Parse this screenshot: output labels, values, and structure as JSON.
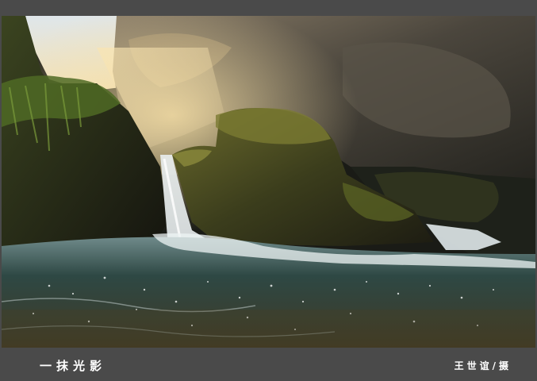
{
  "photo": {
    "subject": "waterfall-rocks-sunlight",
    "colors": {
      "frame": "#4a4a4a",
      "rock_dark": "#1c1d18",
      "rock_mid": "#4a4438",
      "moss": "#4e5a24",
      "sunlight": "#f0d9a0",
      "water": "#2f4a44",
      "foam": "#e8f0f2"
    }
  },
  "caption": {
    "title": "一抹光影",
    "credit": "王世谊/摄"
  }
}
